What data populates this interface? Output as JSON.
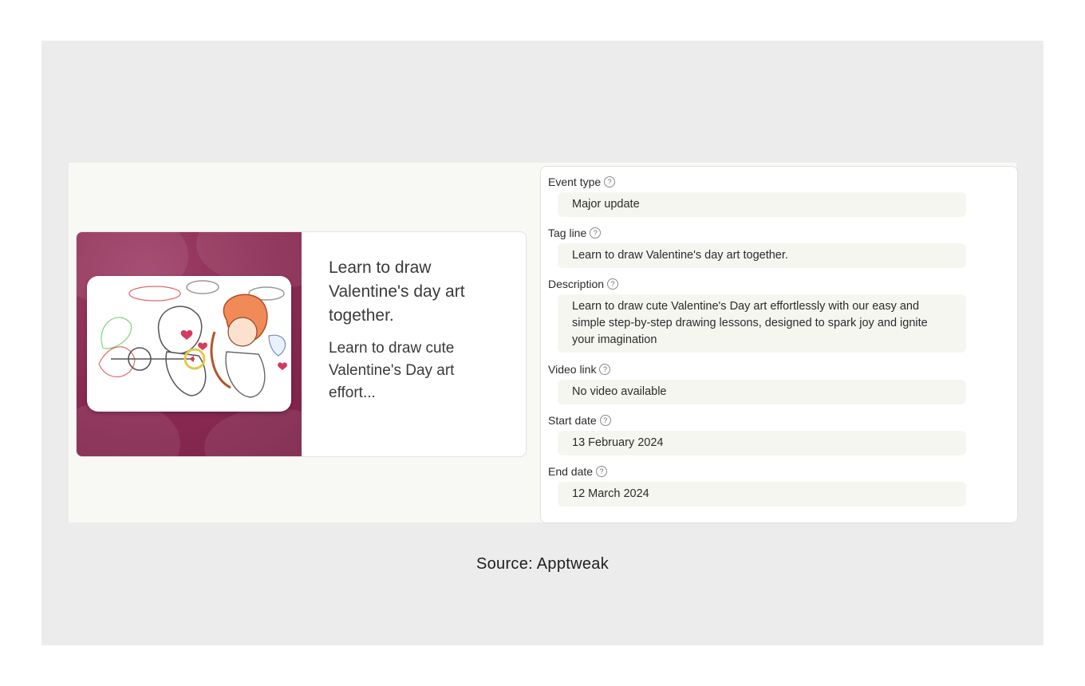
{
  "card": {
    "title": "Learn to draw Valentine's day art together.",
    "description": "Learn to draw cute Valentine's Day art effort..."
  },
  "form": {
    "fields": [
      {
        "label": "Event type",
        "value": "Major update"
      },
      {
        "label": "Tag line",
        "value": "Learn to draw Valentine's day art together."
      },
      {
        "label": "Description",
        "value": "Learn to draw cute Valentine's Day art effortlessly with our easy and simple step-by-step drawing lessons, designed to spark joy and ignite your imagination"
      },
      {
        "label": "Video link",
        "value": "No video available"
      },
      {
        "label": "Start date",
        "value": "13 February 2024"
      },
      {
        "label": "End date",
        "value": "12 March 2024"
      }
    ],
    "help_icon_glyph": "?"
  },
  "caption": "Source: Apptweak",
  "colors": {
    "card_art_bg": "#8a2a52",
    "field_bg": "#f6f6f1",
    "frame_bg": "#ececec"
  }
}
